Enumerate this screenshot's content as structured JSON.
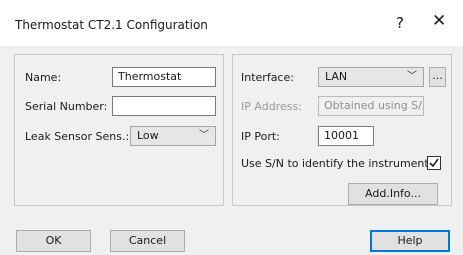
{
  "window": {
    "title": "Thermostat CT2.1 Configuration",
    "help_glyph": "?",
    "close_glyph": "✕"
  },
  "device": {
    "name_label": "Name:",
    "name_value": "Thermostat",
    "serial_label": "Serial Number:",
    "serial_value": "",
    "leak_label": "Leak Sensor Sens.:",
    "leak_value": "Low"
  },
  "connection": {
    "interface_label": "Interface:",
    "interface_value": "LAN",
    "interface_more": "...",
    "ip_label": "IP Address:",
    "ip_value": "Obtained using S/N",
    "port_label": "IP Port:",
    "port_value": "10001",
    "use_sn_label": "Use S/N to identify the instrument:",
    "use_sn_checked": true,
    "addinfo_label": "Add.Info..."
  },
  "footer": {
    "ok_label": "OK",
    "cancel_label": "Cancel",
    "help_label": "Help"
  },
  "colors": {
    "accent": "#0078d7",
    "panel": "#f0f0f0"
  }
}
